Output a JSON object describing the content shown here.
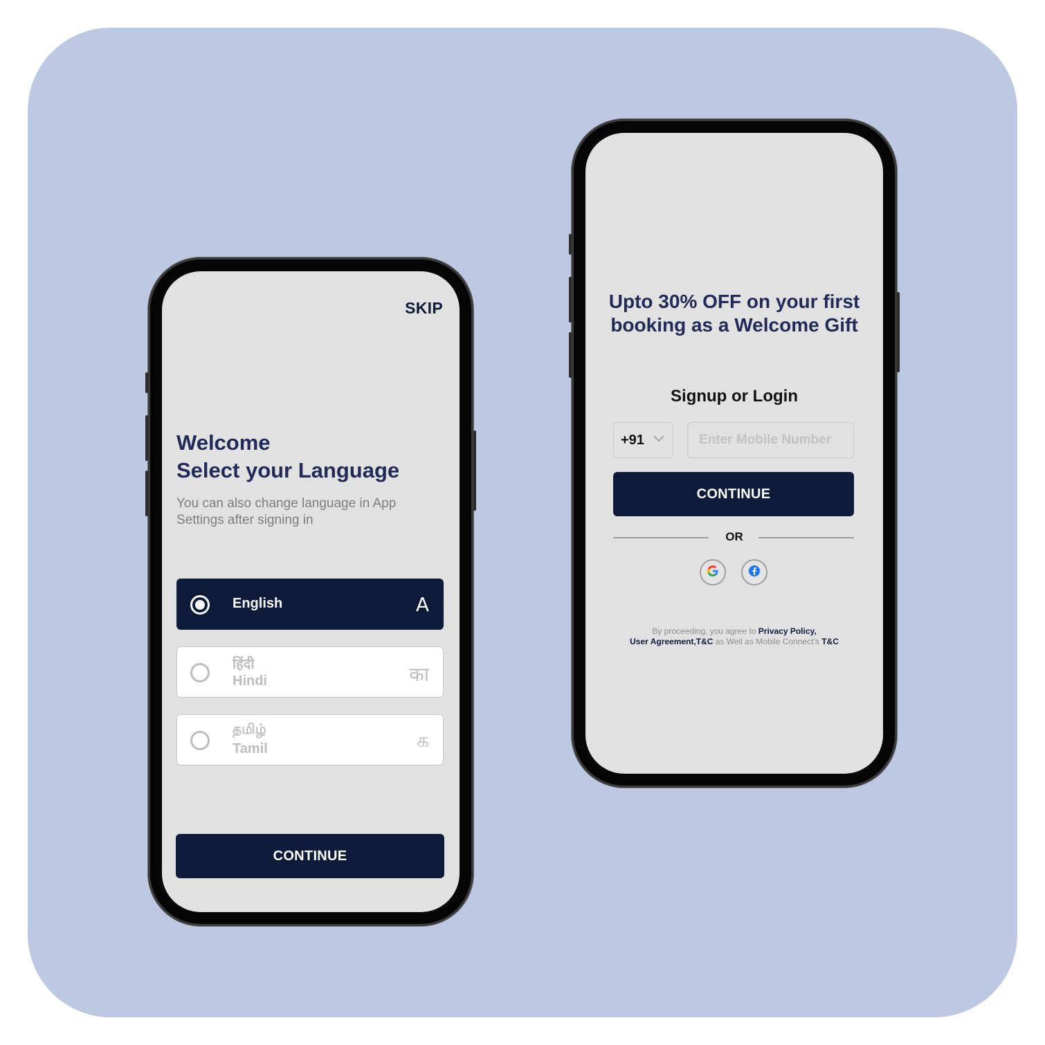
{
  "left_screen": {
    "skip": "SKIP",
    "title": "Welcome\nSelect your Language",
    "subtitle": "You can also change language in App Settings after signing in",
    "languages": [
      {
        "native": "",
        "name": "English",
        "glyph": "A",
        "selected": true
      },
      {
        "native": "हिंदी",
        "name": "Hindi",
        "glyph": "का",
        "selected": false
      },
      {
        "native": "தமிழ்",
        "name": "Tamil",
        "glyph": "க",
        "selected": false
      }
    ],
    "continue_label": "CONTINUE"
  },
  "right_screen": {
    "promo": "Upto 30% OFF on your first\nbooking as a Welcome Gift",
    "signup_title": "Signup or Login",
    "country_code": "+91",
    "mobile_placeholder": "Enter Mobile Number",
    "mobile_value": "",
    "continue_label": "CONTINUE",
    "or_label": "OR",
    "social": [
      {
        "icon": "google-icon"
      },
      {
        "icon": "facebook-icon"
      }
    ],
    "terms": {
      "prefix": "By proceeding, you agree to ",
      "privacy": "Privacy Policy,",
      "agreement": "User Agreement,T&C",
      "middle": " as Well as Mobile Connect's ",
      "tc": "T&C"
    }
  },
  "colors": {
    "backdrop": "#bdc8e2",
    "primary": "#0e1a3a",
    "heading": "#222a57",
    "screen": "#e1e1e1"
  }
}
